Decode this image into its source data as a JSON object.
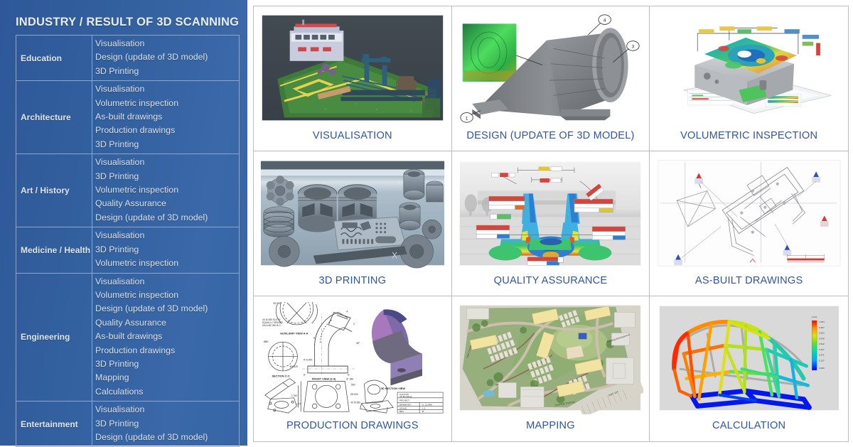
{
  "sidebar": {
    "title": "INDUSTRY / RESULT OF 3D SCANNING",
    "accent_color": "#33609f",
    "text_color": "#dfe4ea",
    "border_color": "#8ea6cd",
    "rows": [
      {
        "category": "Education",
        "results": [
          "Visualisation",
          "Design (update of 3D model)",
          "3D Printing"
        ]
      },
      {
        "category": "Architecture",
        "results": [
          "Visualisation",
          "Volumetric inspection",
          "As-built drawings",
          "Production drawings",
          "3D Printing"
        ]
      },
      {
        "category": "Art / History",
        "results": [
          "Visualisation",
          "3D Printing",
          "Volumetric inspection",
          "Quality Assurance",
          "Design (update of 3D model)"
        ]
      },
      {
        "category": "Medicine / Health",
        "results": [
          "Visualisation",
          "3D Printing",
          "Volumetric inspection"
        ]
      },
      {
        "category": "Engineering",
        "results": [
          "Visualisation",
          "Volumetric inspection",
          "Design (update of 3D model)",
          "Quality Assurance",
          "As-built drawings",
          "Production drawings",
          "3D Printing",
          "Mapping",
          "Calculations"
        ]
      },
      {
        "category": "Entertainment",
        "results": [
          "Visualisation",
          "3D Printing",
          "Design (update of 3D model)"
        ]
      }
    ]
  },
  "gallery": {
    "caption_color": "#2f55a4",
    "border_color": "#b9bcc0",
    "cells": [
      {
        "caption": "VISUALISATION",
        "image_name": "point-cloud-ship-deck-photo"
      },
      {
        "caption": "DESIGN (UPDATE OF 3D MODEL)",
        "image_name": "cad-cone-model-with-callouts"
      },
      {
        "caption": "VOLUMETRIC INSPECTION",
        "image_name": "colormap-gearbox-housing-deviation"
      },
      {
        "caption": "3D PRINTING",
        "image_name": "printed-parts-tray-photo"
      },
      {
        "caption": "QUALITY ASSURANCE",
        "image_name": "fea-colormap-bracket-inspection"
      },
      {
        "caption": "AS-BUILT DRAWINGS",
        "image_name": "floorplan-survey-linework"
      },
      {
        "caption": "PRODUCTION DRAWINGS",
        "image_name": "technical-drawing-elbow-flange"
      },
      {
        "caption": "MAPPING",
        "image_name": "aerial-site-masterplan"
      },
      {
        "caption": "CALCULATION",
        "image_name": "fea-truss-bridge-displacement"
      }
    ]
  }
}
